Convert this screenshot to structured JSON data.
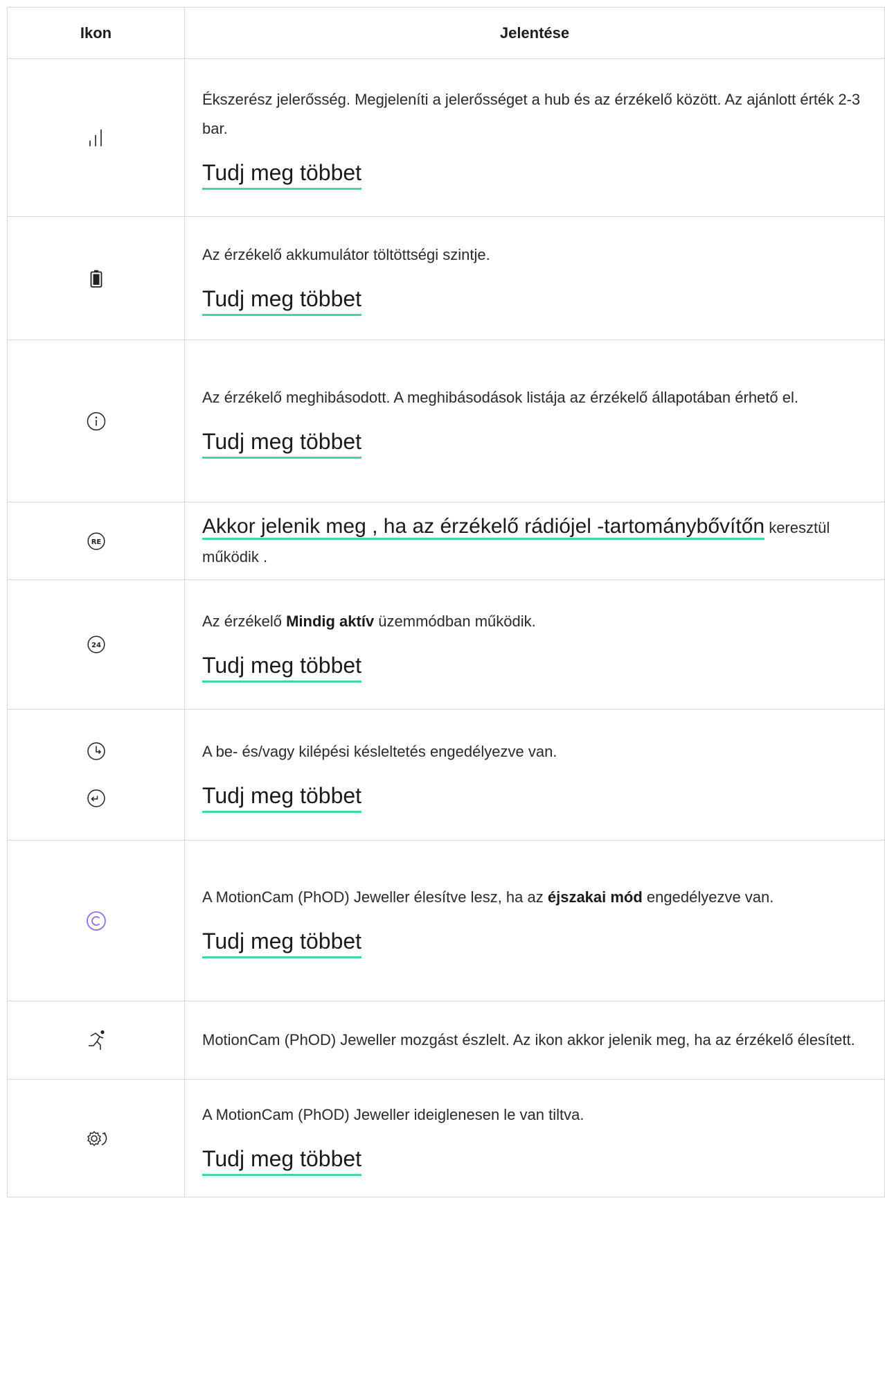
{
  "header": {
    "icon_col": "Ikon",
    "meaning_col": "Jelentése"
  },
  "accent_color": "#41d6a3",
  "night_icon_color": "#8f6ef0",
  "rows": [
    {
      "icon": "signal-strength-icon",
      "text": "Ékszerész jelerősség. Megjeleníti a jelerősséget a hub és az érzékelő között. Az ajánlott érték 2-3 bar.",
      "link": "Tudj meg többet"
    },
    {
      "icon": "battery-icon",
      "text": "Az érzékelő akkumulátor töltöttségi szintje.",
      "link": "Tudj meg többet"
    },
    {
      "icon": "info-icon",
      "text": "Az érzékelő meghibásodott. A meghibásodások listája az érzékelő állapotában érhető el.",
      "link": "Tudj meg többet"
    },
    {
      "icon": "re-icon",
      "link_text": "Akkor jelenik meg , ha az érzékelő rádiójel -tartománybővítőn",
      "rest_text": " keresztül működik ."
    },
    {
      "icon": "24-icon",
      "text_pre": "Az érzékelő ",
      "text_bold": "Mindig aktív",
      "text_post": " üzemmódban működik.",
      "link": "Tudj meg többet"
    },
    {
      "icon": "delay-icons",
      "text": "A be- és/vagy kilépési késleltetés engedélyezve van.",
      "link": "Tudj meg többet"
    },
    {
      "icon": "night-mode-icon",
      "text_pre": "A MotionCam (PhOD) Jeweller élesítve lesz, ha az ",
      "text_bold": "éjszakai mód",
      "text_post": " engedélyezve van.",
      "link": "Tudj meg többet"
    },
    {
      "icon": "motion-detected-icon",
      "text": "MotionCam (PhOD) Jeweller mozgást észlelt. Az ikon akkor jelenik meg, ha az érzékelő élesített."
    },
    {
      "icon": "temporarily-disabled-icon",
      "text": "A MotionCam (PhOD) Jeweller ideiglenesen le van tiltva.",
      "link": "Tudj meg többet"
    }
  ]
}
